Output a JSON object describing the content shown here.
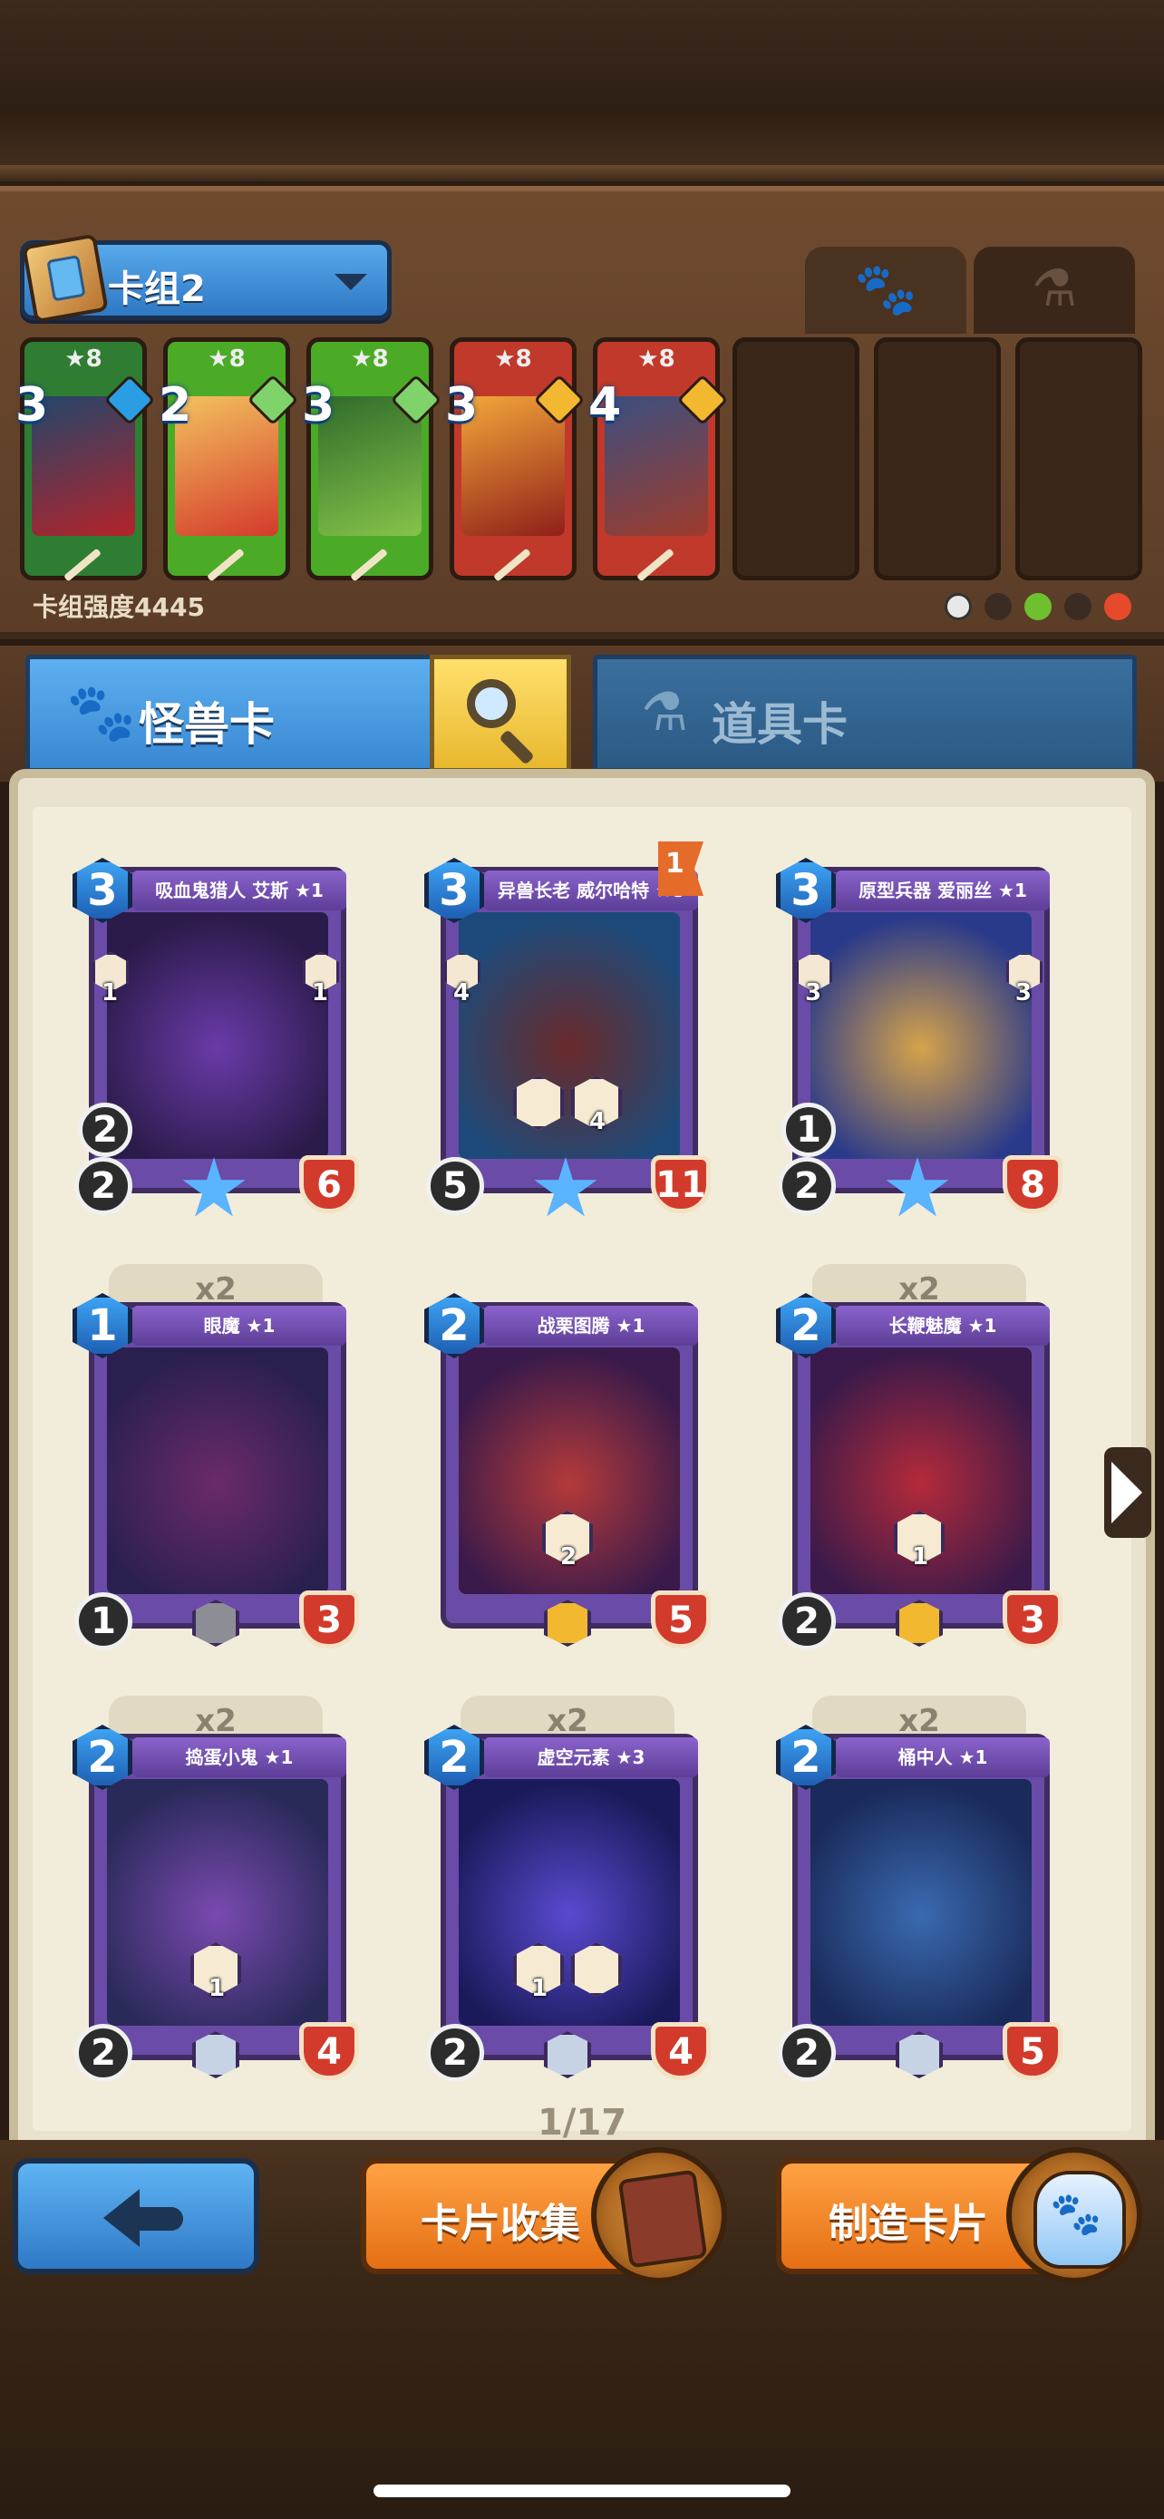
{
  "deck": {
    "selector_label": "卡组2",
    "strength_label": "卡组强度4445",
    "tabs": [
      {
        "name": "monster-deck-tab",
        "icon": "paw-icon",
        "active": true
      },
      {
        "name": "item-deck-tab",
        "icon": "flask-icon",
        "active": false
      }
    ],
    "slots": [
      {
        "level": "★8",
        "cost": "3",
        "gem_color": "#2a9de4",
        "frame_color": "#2e7d32",
        "art": [
          "#22466b",
          "#b4232a"
        ]
      },
      {
        "level": "★8",
        "cost": "2",
        "gem_color": "#7fd36a",
        "frame_color": "#4bab27",
        "art": [
          "#f3c25f",
          "#d43a2b"
        ]
      },
      {
        "level": "★8",
        "cost": "3",
        "gem_color": "#7fd36a",
        "frame_color": "#4bab27",
        "art": [
          "#2f6b2a",
          "#86c34a"
        ]
      },
      {
        "level": "★8",
        "cost": "3",
        "gem_color": "#f2b830",
        "frame_color": "#c0392b",
        "art": [
          "#f3a73a",
          "#8f1f19"
        ]
      },
      {
        "level": "★8",
        "cost": "4",
        "gem_color": "#f2b830",
        "frame_color": "#c0392b",
        "art": [
          "#3b4f80",
          "#9e3b2b"
        ]
      }
    ],
    "element_icons": [
      "neutral-icon",
      "earth-icon",
      "nature-icon",
      "dark-icon",
      "fire-icon"
    ]
  },
  "type_tabs": {
    "monster_label": "怪兽卡",
    "item_label": "道具卡"
  },
  "cards": [
    {
      "name": "吸血鬼猎人 艾斯 ★1",
      "cost": "3",
      "attack": "2",
      "range": "2",
      "hp": "6",
      "rarity": "star",
      "copies": "",
      "art": [
        "#2b1b4a",
        "#6a3aa8"
      ],
      "abilities": [],
      "side_left": "1",
      "side_right": "1",
      "flag": ""
    },
    {
      "name": "异兽长老 威尔哈特 ★8",
      "cost": "3",
      "attack": "5",
      "range": "",
      "hp": "11",
      "rarity": "star",
      "copies": "",
      "art": [
        "#1d4a7a",
        "#6a2a2a"
      ],
      "abilities": [
        "",
        "4"
      ],
      "side_left": "4",
      "side_right": "",
      "flag": "1"
    },
    {
      "name": "原型兵器 爱丽丝 ★1",
      "cost": "3",
      "attack": "2",
      "range": "1",
      "hp": "8",
      "rarity": "star",
      "copies": "",
      "art": [
        "#2a3a8a",
        "#d6a34a"
      ],
      "abilities": [],
      "side_left": "3",
      "side_right": "3",
      "flag": ""
    },
    {
      "name": "眼魔 ★1",
      "cost": "1",
      "attack": "1",
      "range": "",
      "hp": "3",
      "rarity": "gray",
      "copies": "x2",
      "art": [
        "#2a2050",
        "#6b2a6a"
      ],
      "abilities": [],
      "side_left": "",
      "side_right": "",
      "flag": ""
    },
    {
      "name": "战栗图腾 ★1",
      "cost": "2",
      "attack": "",
      "range": "",
      "hp": "5",
      "rarity": "gold",
      "copies": "",
      "art": [
        "#3a1a4a",
        "#b43a3a"
      ],
      "abilities": [
        "2"
      ],
      "side_left": "",
      "side_right": "",
      "flag": ""
    },
    {
      "name": "长鞭魅魔 ★1",
      "cost": "2",
      "attack": "2",
      "range": "",
      "hp": "3",
      "rarity": "gold",
      "copies": "x2",
      "art": [
        "#3a1a4a",
        "#b42a3a"
      ],
      "abilities": [
        "1"
      ],
      "side_left": "",
      "side_right": "",
      "flag": ""
    },
    {
      "name": "捣蛋小鬼 ★1",
      "cost": "2",
      "attack": "2",
      "range": "",
      "hp": "4",
      "rarity": "silver",
      "copies": "x2",
      "art": [
        "#2a2a5a",
        "#7a4ab0"
      ],
      "abilities": [
        "1"
      ],
      "side_left": "",
      "side_right": "",
      "flag": ""
    },
    {
      "name": "虚空元素 ★3",
      "cost": "2",
      "attack": "2",
      "range": "",
      "hp": "4",
      "rarity": "silver",
      "copies": "x2",
      "art": [
        "#1a1a5a",
        "#5a4ad0"
      ],
      "abilities": [
        "1",
        ""
      ],
      "side_left": "",
      "side_right": "",
      "flag": ""
    },
    {
      "name": "桶中人 ★1",
      "cost": "2",
      "attack": "2",
      "range": "",
      "hp": "5",
      "rarity": "silver",
      "copies": "x2",
      "art": [
        "#1a2a5a",
        "#3a6ab0"
      ],
      "abilities": [],
      "side_left": "",
      "side_right": "",
      "flag": ""
    }
  ],
  "pagination": {
    "label": "1/17"
  },
  "bottom": {
    "collect_label": "卡片收集",
    "craft_label": "制造卡片"
  }
}
